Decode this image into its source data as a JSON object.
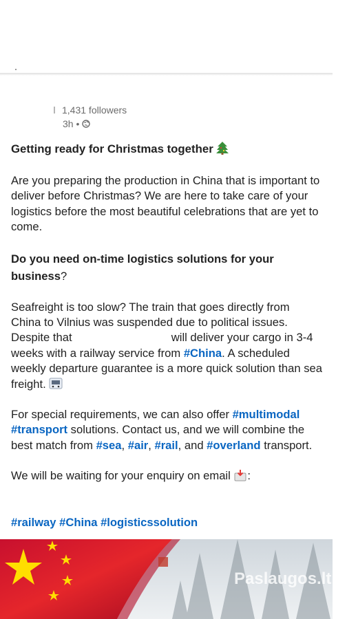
{
  "post": {
    "followers": "1,431 followers",
    "time": "3h •",
    "title": "Getting ready for Christmas together",
    "p1": "Are you preparing the production in China that is important to deliver before Christmas? We are here to take care of your logistics before the most beautiful celebrations that are yet to come.",
    "q_bold": "Do you need on-time logistics solutions for your business",
    "q_end": "?",
    "p2_a": "Seafreight is too slow? The train that goes directly from China to Vilnius was suspended due to political issues. Despite that ",
    "p2_b": " will deliver your cargo in 3-4 weeks with a railway service from ",
    "p2_tag": "#China",
    "p2_c": ". A scheduled weekly departure guarantee is a more quick solution than sea freight. ",
    "p3_a": "For special requirements, we can also offer ",
    "p3_tag1": "#multimodal",
    "p3_tag2": "#transport",
    "p3_b": " solutions. Contact us, and we will combine the best match from ",
    "p3_sea": "#sea",
    "p3_sep1": ", ",
    "p3_air": "#air",
    "p3_sep2": ", ",
    "p3_rail": "#rail",
    "p3_and": ", and ",
    "p3_overland": "#overland",
    "p3_end": " transport.",
    "p4": "We will be waiting for your enquiry on email ",
    "p4_end": ":",
    "tags": [
      "#railway",
      "#China",
      "#logisticssolution"
    ],
    "image_watermark": "Paslaugos.lt"
  },
  "colors": {
    "hashtag": "#0a66c2",
    "text": "#222222",
    "meta": "#6b6b6b"
  }
}
